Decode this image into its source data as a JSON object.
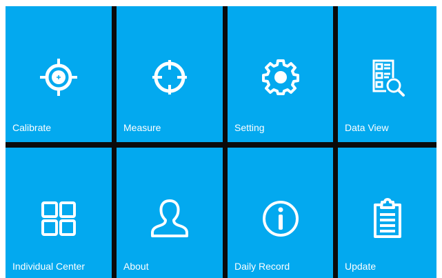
{
  "tiles": [
    {
      "label": "Calibrate",
      "icon": "crosshair-target-icon"
    },
    {
      "label": "Measure",
      "icon": "crosshair-circle-icon"
    },
    {
      "label": "Setting",
      "icon": "gear-icon"
    },
    {
      "label": "Data View",
      "icon": "document-search-icon"
    },
    {
      "label": "Individual Center",
      "icon": "grid-icon"
    },
    {
      "label": "About",
      "icon": "person-icon"
    },
    {
      "label": "Daily Record",
      "icon": "info-icon"
    },
    {
      "label": "Update",
      "icon": "clipboard-icon"
    }
  ],
  "colors": {
    "tile": "#03a9ef",
    "divider": "#0b0b0b",
    "foreground": "#ffffff"
  }
}
